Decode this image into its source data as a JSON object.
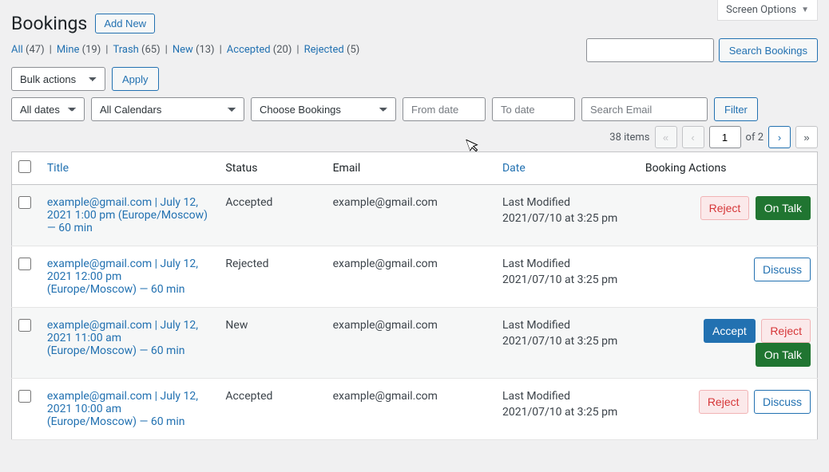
{
  "screen_options_label": "Screen Options",
  "page_title": "Bookings",
  "add_new_label": "Add New",
  "views": {
    "all": {
      "label": "All",
      "count": "(47)"
    },
    "mine": {
      "label": "Mine",
      "count": "(19)"
    },
    "trash": {
      "label": "Trash",
      "count": "(65)"
    },
    "new": {
      "label": "New",
      "count": "(13)"
    },
    "accepted": {
      "label": "Accepted",
      "count": "(20)"
    },
    "rejected": {
      "label": "Rejected",
      "count": "(5)"
    }
  },
  "search_bookings_label": "Search Bookings",
  "bulk_actions_label": "Bulk actions",
  "apply_label": "Apply",
  "filters": {
    "all_dates": "All dates",
    "all_calendars": "All Calendars",
    "choose_bookings": "Choose Bookings",
    "from_date_ph": "From date",
    "to_date_ph": "To date",
    "search_email_ph": "Search Email",
    "filter_label": "Filter"
  },
  "pagination": {
    "items_text": "38 items",
    "current": "1",
    "of_text": "of 2"
  },
  "columns": {
    "title": "Title",
    "status": "Status",
    "email": "Email",
    "date": "Date",
    "actions": "Booking Actions"
  },
  "actions": {
    "accept": "Accept",
    "reject": "Reject",
    "ontalk": "On Talk",
    "discuss": "Discuss"
  },
  "rows": [
    {
      "title": "example@gmail.com | July 12, 2021 1:00 pm (Europe/Moscow) — 60 min",
      "status": "Accepted",
      "email": "example@gmail.com",
      "date_label": "Last Modified",
      "date_value": "2021/07/10 at 3:25 pm"
    },
    {
      "title": "example@gmail.com | July 12, 2021 12:00 pm (Europe/Moscow) — 60 min",
      "status": "Rejected",
      "email": "example@gmail.com",
      "date_label": "Last Modified",
      "date_value": "2021/07/10 at 3:25 pm"
    },
    {
      "title": "example@gmail.com | July 12, 2021 11:00 am (Europe/Moscow) — 60 min",
      "status": "New",
      "email": "example@gmail.com",
      "date_label": "Last Modified",
      "date_value": "2021/07/10 at 3:25 pm"
    },
    {
      "title": "example@gmail.com | July 12, 2021 10:00 am (Europe/Moscow) — 60 min",
      "status": "Accepted",
      "email": "example@gmail.com",
      "date_label": "Last Modified",
      "date_value": "2021/07/10 at 3:25 pm"
    }
  ]
}
